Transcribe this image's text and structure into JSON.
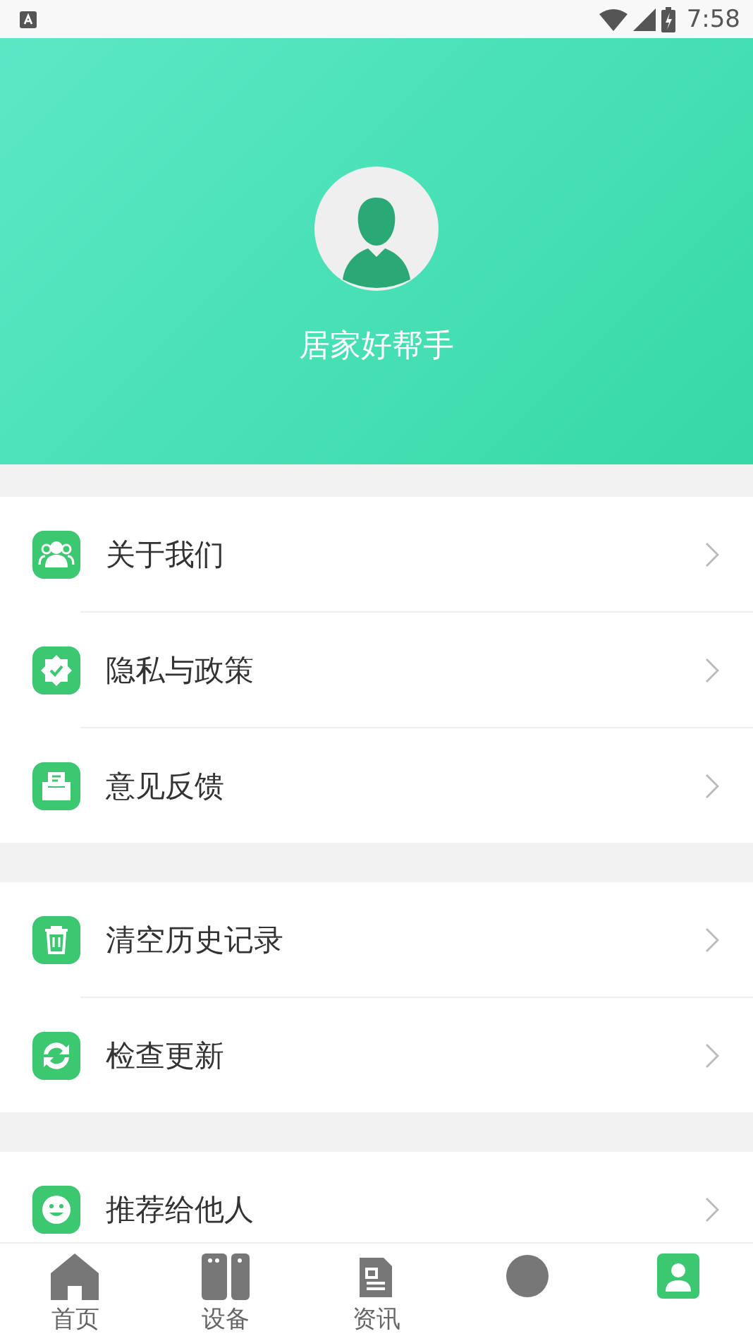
{
  "status_bar": {
    "time": "7:58"
  },
  "profile": {
    "name": "居家好帮手"
  },
  "menu_groups": [
    [
      {
        "kind": "people",
        "label": "关于我们"
      },
      {
        "kind": "shield",
        "label": "隐私与政策"
      },
      {
        "kind": "inbox",
        "label": "意见反馈"
      }
    ],
    [
      {
        "kind": "trash",
        "label": "清空历史记录"
      },
      {
        "kind": "refresh",
        "label": "检查更新"
      }
    ],
    [
      {
        "kind": "smile",
        "label": "推荐给他人"
      }
    ]
  ],
  "tabs": [
    {
      "kind": "home",
      "label": "首页",
      "selected": false
    },
    {
      "kind": "devices",
      "label": "设备",
      "selected": false
    },
    {
      "kind": "news",
      "label": "资讯",
      "selected": false
    },
    {
      "kind": "circle",
      "selected": false
    },
    {
      "kind": "person",
      "selected": true
    }
  ]
}
